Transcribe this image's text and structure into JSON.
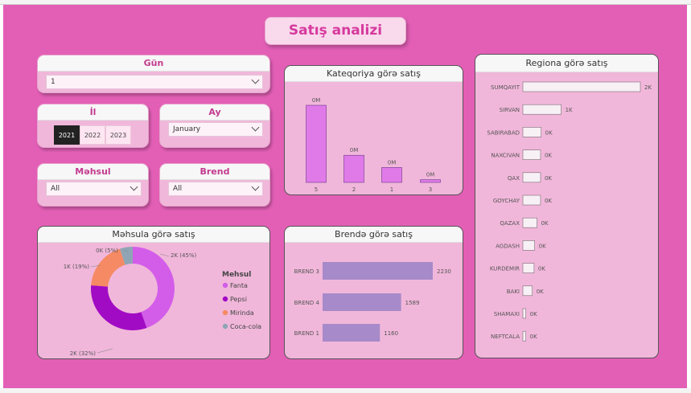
{
  "page_title": "Satış analizi",
  "colors": {
    "background": "#e35fb6",
    "card": "#f1b7da",
    "title_text": "#d6399e",
    "accent": "#c23b8e"
  },
  "slicers": {
    "gun": {
      "label": "Gün",
      "value": "1"
    },
    "il": {
      "label": "İl",
      "years": [
        "2021",
        "2022",
        "2023"
      ],
      "selected": "2021"
    },
    "ay": {
      "label": "Ay",
      "value": "January"
    },
    "mehsul": {
      "label": "Məhsul",
      "value": "All"
    },
    "brend": {
      "label": "Brend",
      "value": "All"
    }
  },
  "chart_data": [
    {
      "id": "kateqoriya",
      "type": "bar",
      "title": "Kateqoriya görə satış",
      "categories": [
        "5",
        "2",
        "1",
        "3"
      ],
      "values": [
        0.00196,
        0.00069,
        0.00038,
        7e-05
      ],
      "data_labels": [
        "0M",
        "0M",
        "0M",
        "0M"
      ],
      "bar_color": "#e07ae9"
    },
    {
      "id": "mehsul",
      "type": "pie",
      "title": "Məhsula görə satış",
      "legend_title": "Mehsul",
      "legend_position": "right",
      "categories": [
        "Fanta",
        "Pepsi",
        "Mirinda",
        "Coca-cola"
      ],
      "values": [
        45,
        32,
        19,
        5
      ],
      "data_labels": [
        "2K (45%)",
        "2K (32%)",
        "1K (19%)",
        "0K (5%)"
      ],
      "colors": [
        "#d35de8",
        "#a20bc4",
        "#f58a64",
        "#8fa5b5"
      ]
    },
    {
      "id": "brend",
      "type": "bar",
      "orientation": "horizontal",
      "title": "Brendə görə satış",
      "categories": [
        "BREND 3",
        "BREND 4",
        "BREND 1"
      ],
      "values": [
        2230,
        1589,
        1160
      ],
      "data_labels": [
        "2230",
        "1589",
        "1160"
      ],
      "bar_color": "#a68ac9"
    },
    {
      "id": "region",
      "type": "bar",
      "orientation": "horizontal",
      "title": "Regiona görə satış",
      "categories": [
        "SUMQAYIT",
        "SIRVAN",
        "SABIRABAD",
        "NAXCIVAN",
        "QAX",
        "GOYCHAY",
        "QAZAX",
        "AGDASH",
        "KURDEMIR",
        "BAKI",
        "SHAMAXI",
        "NEFTCALA"
      ],
      "values": [
        1995,
        650,
        310,
        300,
        300,
        300,
        240,
        200,
        190,
        160,
        50,
        50
      ],
      "data_labels": [
        "2K",
        "1K",
        "0K",
        "0K",
        "0K",
        "0K",
        "0K",
        "0K",
        "0K",
        "0K",
        "0K",
        "0K"
      ],
      "bar_color": "#f7f0f5"
    }
  ]
}
